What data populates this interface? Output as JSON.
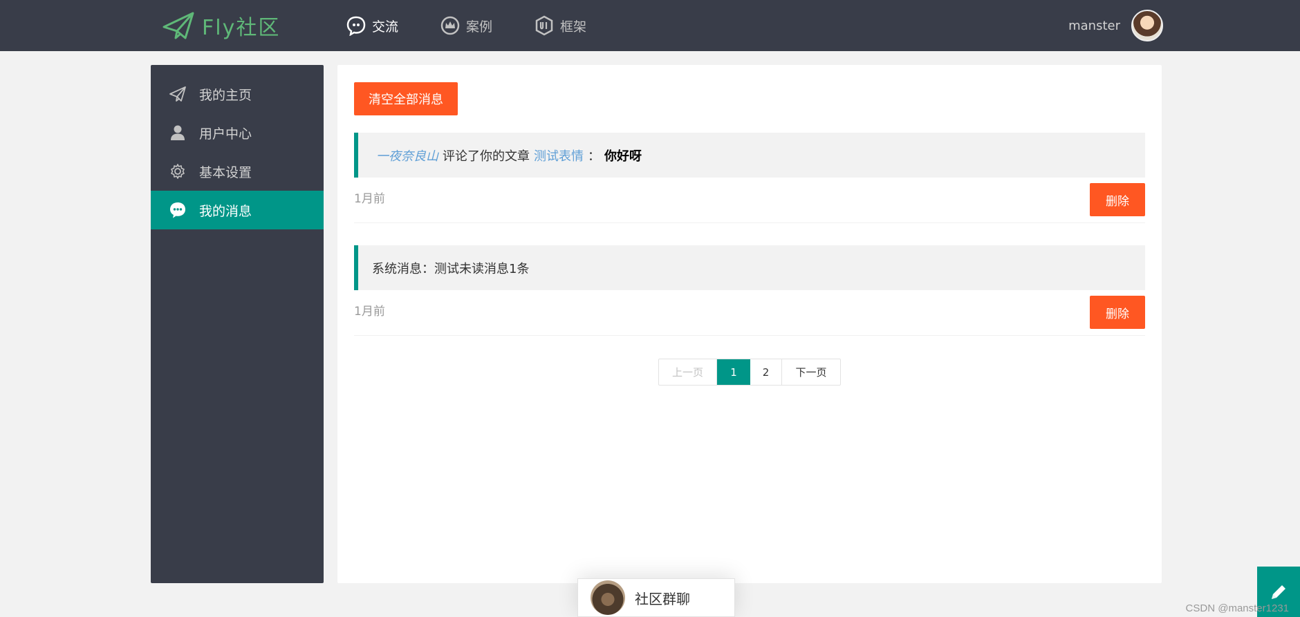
{
  "header": {
    "logo_text": "Fly社区",
    "nav": [
      {
        "label": "交流",
        "icon": "chat-bubble-icon",
        "active": true
      },
      {
        "label": "案例",
        "icon": "crown-icon",
        "active": false
      },
      {
        "label": "框架",
        "icon": "ui-badge-icon",
        "active": false
      }
    ],
    "username": "manster"
  },
  "sidebar": {
    "items": [
      {
        "label": "我的主页",
        "icon": "paper-plane-icon"
      },
      {
        "label": "用户中心",
        "icon": "user-icon"
      },
      {
        "label": "基本设置",
        "icon": "gear-icon"
      },
      {
        "label": "我的消息",
        "icon": "message-icon",
        "active": true
      }
    ]
  },
  "main": {
    "clear_all_label": "清空全部消息",
    "messages": [
      {
        "user": "一夜奈良山",
        "action": "评论了你的文章",
        "post": "测试表情",
        "separator": "：",
        "content": "你好呀",
        "time": "1月前",
        "delete_label": "删除"
      },
      {
        "text": "系统消息：测试未读消息1条",
        "time": "1月前",
        "delete_label": "删除"
      }
    ],
    "pager": {
      "prev": "上一页",
      "current": "1",
      "page2": "2",
      "next": "下一页"
    }
  },
  "chat": {
    "label": "社区群聊"
  },
  "watermark": "CSDN @manster1231",
  "colors": {
    "header_bg": "#393d49",
    "accent_green": "#009688",
    "accent_orange": "#ff5722",
    "logo_green": "#5fb878",
    "link_blue": "#5f9fd6"
  }
}
